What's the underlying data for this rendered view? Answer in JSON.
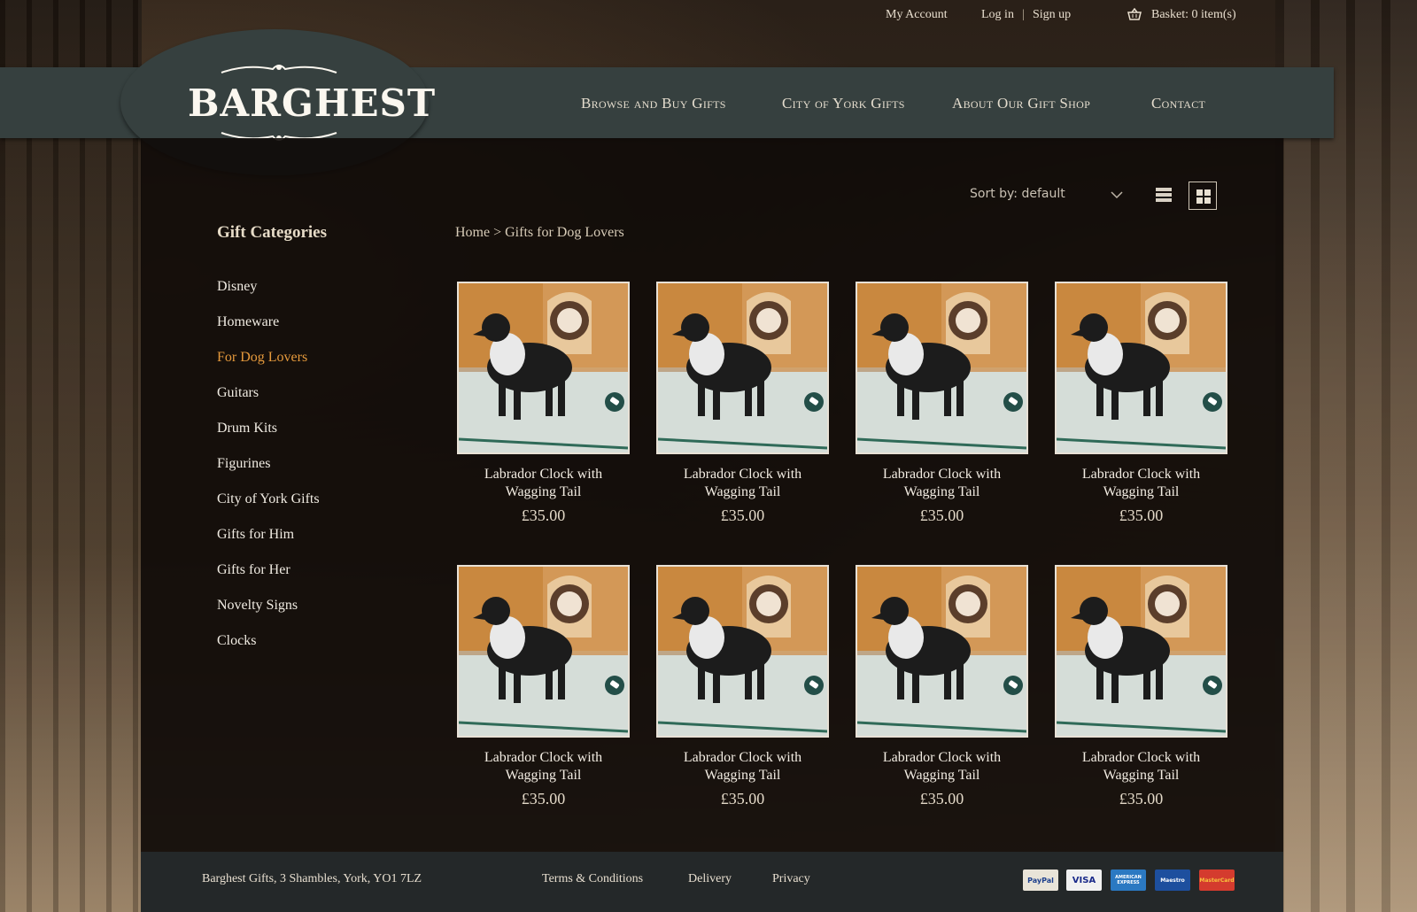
{
  "header": {
    "util_links": {
      "my_account": "My Account",
      "log_in": "Log in",
      "separator": "|",
      "sign_up": "Sign up",
      "basket": "Basket: 0 item(s)"
    },
    "logo": "BARGHEST",
    "nav": [
      "Browse and Buy Gifts",
      "City of York Gifts",
      "About Our Gift Shop",
      "Contact"
    ]
  },
  "sidebar": {
    "title": "Gift Categories",
    "items": [
      {
        "label": "Disney",
        "active": false
      },
      {
        "label": "Homeware",
        "active": false
      },
      {
        "label": "For Dog Lovers",
        "active": true
      },
      {
        "label": "Guitars",
        "active": false
      },
      {
        "label": "Drum Kits",
        "active": false
      },
      {
        "label": "Figurines",
        "active": false
      },
      {
        "label": "City of York Gifts",
        "active": false
      },
      {
        "label": "Gifts for Him",
        "active": false
      },
      {
        "label": "Gifts for Her",
        "active": false
      },
      {
        "label": "Novelty Signs",
        "active": false
      },
      {
        "label": "Clocks",
        "active": false
      }
    ]
  },
  "main": {
    "breadcrumb": "Home > Gifts for Dog Lovers",
    "sort_label": "Sort by: default",
    "products": [
      {
        "title_line1": "Labrador Clock with",
        "title_line2": "Wagging Tail",
        "price": "£35.00"
      },
      {
        "title_line1": "Labrador Clock with",
        "title_line2": "Wagging Tail",
        "price": "£35.00"
      },
      {
        "title_line1": "Labrador Clock with",
        "title_line2": "Wagging Tail",
        "price": "£35.00"
      },
      {
        "title_line1": "Labrador Clock with",
        "title_line2": "Wagging Tail",
        "price": "£35.00"
      },
      {
        "title_line1": "Labrador Clock with",
        "title_line2": "Wagging Tail",
        "price": "£35.00"
      },
      {
        "title_line1": "Labrador Clock with",
        "title_line2": "Wagging Tail",
        "price": "£35.00"
      },
      {
        "title_line1": "Labrador Clock with",
        "title_line2": "Wagging Tail",
        "price": "£35.00"
      },
      {
        "title_line1": "Labrador Clock with",
        "title_line2": "Wagging Tail",
        "price": "£35.00"
      }
    ]
  },
  "footer": {
    "address": "Barghest Gifts, 3 Shambles, York, YO1 7LZ",
    "links": [
      "Terms & Conditions",
      "Delivery",
      "Privacy"
    ],
    "payment": [
      "PayPal",
      "VISA",
      "AMERICAN EXPRESS",
      "Maestro",
      "MasterCard"
    ]
  },
  "colors": {
    "nav_band": "#36403f",
    "active_category": "#e69a3c",
    "footer": "#242829"
  }
}
